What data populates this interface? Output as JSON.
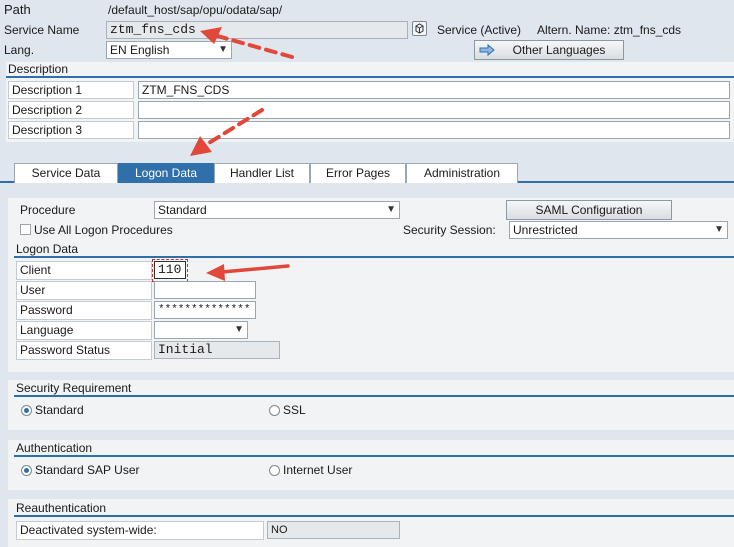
{
  "header": {
    "path_label": "Path",
    "path_value": "/default_host/sap/opu/odata/sap/",
    "service_name_label": "Service Name",
    "service_name_value": "ztm_fns_cds",
    "service_status": "Service (Active)",
    "altern_name": "Altern. Name: ztm_fns_cds",
    "lang_label": "Lang.",
    "lang_value": "EN English",
    "other_languages_button": "Other Languages"
  },
  "description": {
    "title": "Description",
    "rows": [
      {
        "label": "Description 1",
        "value": "ZTM_FNS_CDS"
      },
      {
        "label": "Description 2",
        "value": ""
      },
      {
        "label": "Description 3",
        "value": ""
      }
    ]
  },
  "tabs": [
    {
      "label": "Service Data"
    },
    {
      "label": "Logon Data"
    },
    {
      "label": "Handler List"
    },
    {
      "label": "Error Pages"
    },
    {
      "label": "Administration"
    }
  ],
  "logon": {
    "procedure_label": "Procedure",
    "procedure_value": "Standard",
    "saml_button": "SAML Configuration",
    "use_all_label": "Use All Logon Procedures",
    "security_session_label": "Security Session:",
    "security_session_value": "Unrestricted",
    "group_title": "Logon Data",
    "client_label": "Client",
    "client_value": "110",
    "user_label": "User",
    "user_value": "",
    "password_label": "Password",
    "password_value": "**************",
    "language_label": "Language",
    "language_value": "",
    "password_status_label": "Password Status",
    "password_status_value": "Initial"
  },
  "security": {
    "title": "Security Requirement",
    "option_standard": "Standard",
    "option_ssl": "SSL"
  },
  "authentication": {
    "title": "Authentication",
    "option_standard": "Standard SAP User",
    "option_internet": "Internet User"
  },
  "reauth": {
    "title": "Reauthentication",
    "deactivated_label": "Deactivated system-wide:",
    "deactivated_value": "NO"
  },
  "colors": {
    "accent": "#2f6faa",
    "annotation": "#e2483a"
  }
}
